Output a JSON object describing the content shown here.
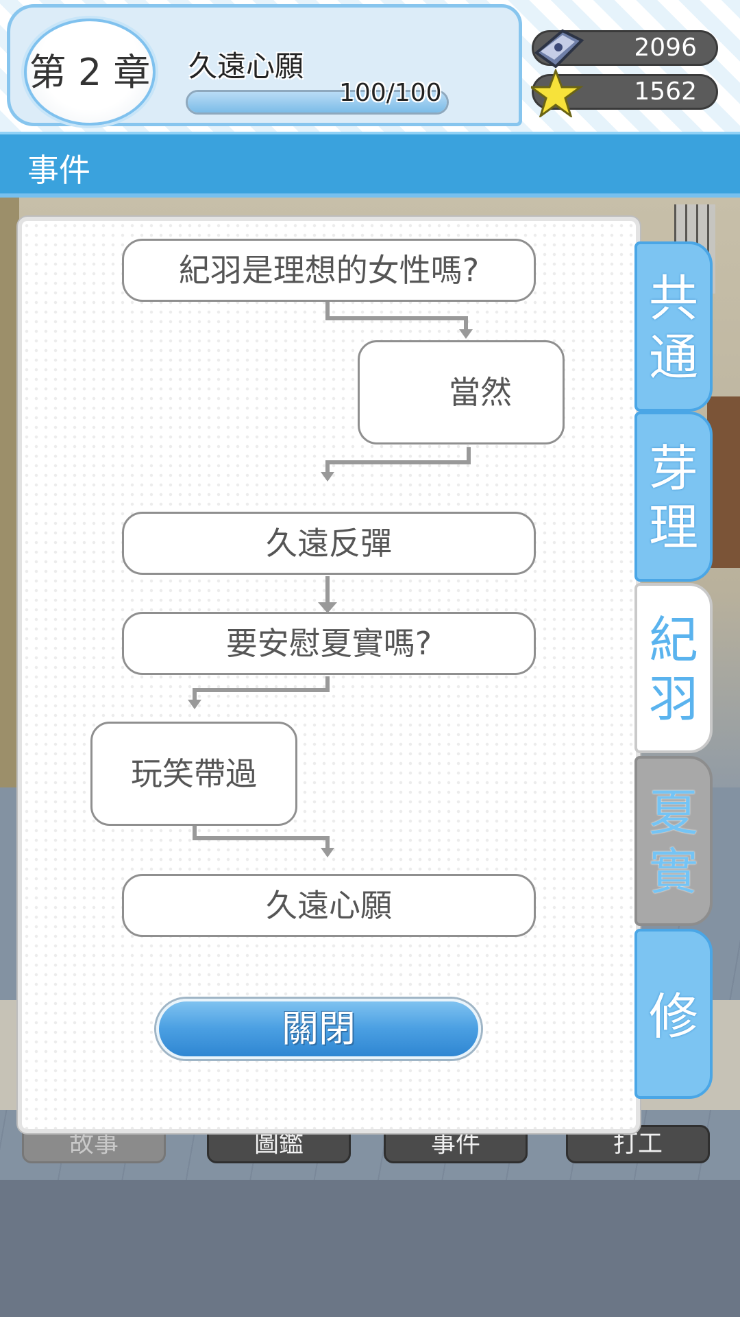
{
  "header": {
    "chapter": "第 2 章",
    "chapter_title": "久遠心願",
    "progress_text": "100/100",
    "progress_fraction": 1.0,
    "currency_gem": "2096",
    "currency_star": "1562"
  },
  "section": {
    "title": "事件"
  },
  "bottom_nav": [
    "故事",
    "圖鑑",
    "事件",
    "打工"
  ],
  "flow": {
    "node_1": "紀羽是理想的女性嗎?",
    "node_2": "當然",
    "node_3": "久遠反彈",
    "node_4": "要安慰夏實嗎?",
    "node_5": "玩笑帶過",
    "node_6": "久遠心願"
  },
  "dialog": {
    "close_label": "關閉"
  },
  "tabs": {
    "common": "共通",
    "mari": "芽理",
    "kiu": "紀羽",
    "natsumi": "夏實",
    "shu": "修",
    "active": "紀羽"
  },
  "colors": {
    "accent": "#3aa2dd",
    "tab_blue": "#7cc4f2",
    "button_blue": "#4a9fe2",
    "node_border": "#8f8f8f"
  }
}
